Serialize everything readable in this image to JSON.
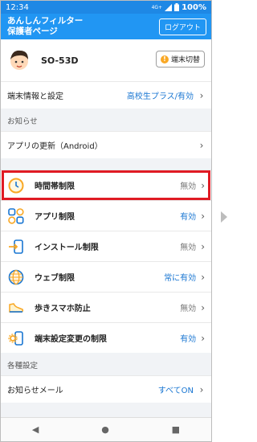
{
  "status_bar": {
    "time": "12:34",
    "network": "4G+",
    "battery": "100%"
  },
  "app_bar": {
    "title_line1": "あんしんフィルター",
    "title_line2": "保護者ページ",
    "logout_label": "ログアウト"
  },
  "device": {
    "name": "SO-53D",
    "switch_label": "端末切替"
  },
  "device_settings": {
    "label": "端末情報と設定",
    "value": "高校生プラス/有効"
  },
  "notices": {
    "header": "お知らせ",
    "items": [
      {
        "label": "アプリの更新（Android）"
      }
    ]
  },
  "features": [
    {
      "label": "時間帯制限",
      "value": "無効",
      "icon": "clock-icon",
      "value_color": "gray"
    },
    {
      "label": "アプリ制限",
      "value": "有効",
      "icon": "apps-icon",
      "value_color": "blue"
    },
    {
      "label": "インストール制限",
      "value": "無効",
      "icon": "install-icon",
      "value_color": "gray"
    },
    {
      "label": "ウェブ制限",
      "value": "常に有効",
      "icon": "globe-icon",
      "value_color": "blue"
    },
    {
      "label": "歩きスマホ防止",
      "value": "無効",
      "icon": "sneaker-icon",
      "value_color": "gray"
    },
    {
      "label": "端末設定変更の制限",
      "value": "有効",
      "icon": "settings-phone-icon",
      "value_color": "blue"
    }
  ],
  "settings": {
    "header": "各種設定",
    "items": [
      {
        "label": "お知らせメール",
        "value": "すべてON"
      }
    ]
  },
  "nav": {
    "back": "◀",
    "home": "●",
    "recents": "■"
  },
  "colors": {
    "primary": "#2196f3",
    "highlight": "#e01b24",
    "link": "#1976d2"
  }
}
